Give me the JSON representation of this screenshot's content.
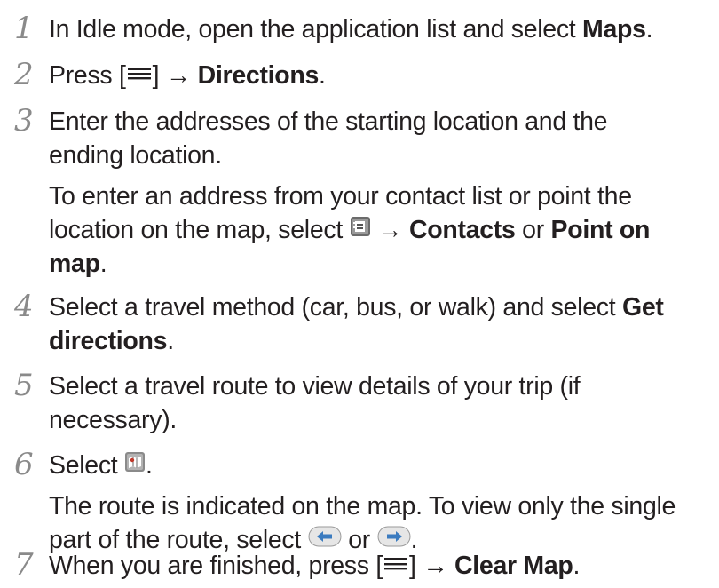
{
  "steps": [
    {
      "number": "1",
      "text_before": "In Idle mode, open the application list and select ",
      "bold": "Maps",
      "text_after": "."
    },
    {
      "number": "2",
      "text_before": "Press [",
      "menu_key_icon": "menu-key-icon",
      "text_mid": "] → ",
      "bold": "Directions",
      "text_after": "."
    },
    {
      "number": "3",
      "line1": "Enter the addresses of the starting location and the",
      "line2": "ending location.",
      "note_line1": "To enter an address from your contact list or point the",
      "note_line2_before": "location on the map, select ",
      "contacts_icon": "contact-book-icon",
      "note_line2_arrow": " → ",
      "note_bold1": "Contacts",
      "note_or": " or ",
      "note_bold2": "Point on",
      "note_line3_bold": "map",
      "note_line3_after": "."
    },
    {
      "number": "4",
      "line1_before": "Select a travel method (car, bus, or walk) and select ",
      "line1_bold": "Get",
      "line2_bold": "directions",
      "line2_after": "."
    },
    {
      "number": "5",
      "line1": "Select a travel route to view details of your trip (if",
      "line2": "necessary)."
    },
    {
      "number": "6",
      "text_before": "Select ",
      "map_icon": "map-view-icon",
      "text_after": ".",
      "note_line1": "The route is indicated on the map. To view only the single",
      "note_line2_before": "part of the route, select ",
      "prev_icon": "left-arrow-icon",
      "note_or": " or ",
      "next_icon": "right-arrow-icon",
      "note_line2_after": "."
    },
    {
      "number": "7",
      "text_before": "When you are finished, press [",
      "menu_key_icon": "menu-key-icon",
      "text_mid": "] → ",
      "bold": "Clear Map",
      "text_after": "."
    }
  ]
}
